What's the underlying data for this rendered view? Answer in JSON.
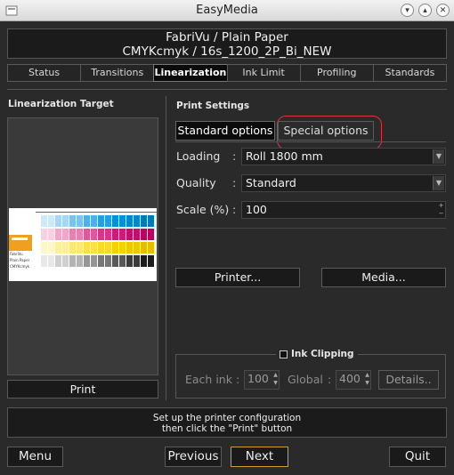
{
  "window": {
    "title": "EasyMedia"
  },
  "header": {
    "line1": "FabriVu / Plain Paper",
    "line2": "CMYKcmyk / 16s_1200_2P_Bi_NEW"
  },
  "tabs": [
    {
      "label": "Status"
    },
    {
      "label": "Transitions"
    },
    {
      "label": "Linearization",
      "active": true
    },
    {
      "label": "Ink Limit"
    },
    {
      "label": "Profiling"
    },
    {
      "label": "Standards"
    }
  ],
  "left": {
    "title": "Linearization Target",
    "print_button": "Print",
    "target_labels": {
      "small1": "FabriVu",
      "small2": "Plain Paper",
      "small3": "CMYKcmyk"
    }
  },
  "right": {
    "title": "Print Settings",
    "options": {
      "standard": "Standard options",
      "special": "Special options"
    },
    "loading": {
      "label": "Loading",
      "value": "Roll 1800 mm"
    },
    "quality": {
      "label": "Quality",
      "value": "Standard"
    },
    "scale": {
      "label": "Scale (%)",
      "value": "100"
    },
    "printer_button": "Printer...",
    "media_button": "Media...",
    "ink_clipping": {
      "label": "Ink Clipping",
      "checked": false,
      "each_ink_label": "Each ink",
      "each_ink_value": "100",
      "global_label": "Global",
      "global_value": "400",
      "details_button": "Details.."
    }
  },
  "status": {
    "line1": "Set up the printer configuration",
    "line2": "then click the \"Print\" button"
  },
  "footer": {
    "menu": "Menu",
    "previous": "Previous",
    "next": "Next",
    "quit": "Quit"
  },
  "colors": {
    "highlight": "#e0323c",
    "next_border": "#d49a2a"
  }
}
